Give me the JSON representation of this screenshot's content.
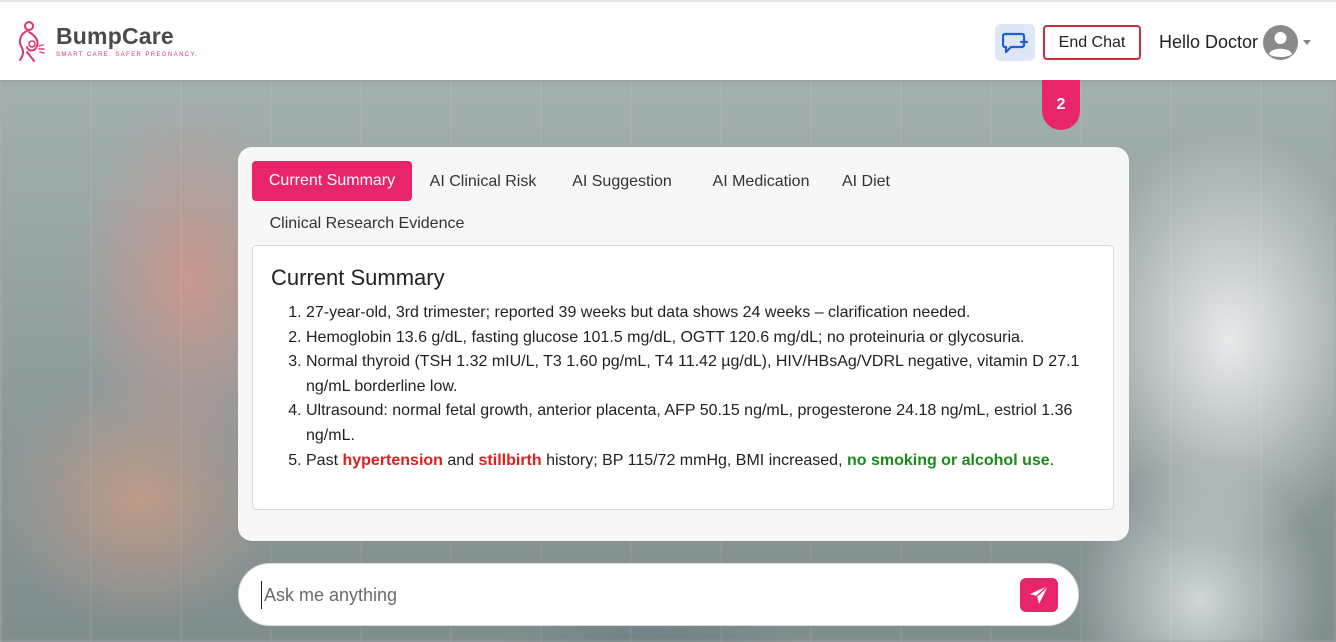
{
  "app": {
    "name": "BumpCare",
    "tagline": "SMART CARE. SAFER PREGNANCY."
  },
  "header": {
    "end_chat_label": "End Chat",
    "greeting": "Hello Doctor",
    "notification_count": "2"
  },
  "tabs": [
    {
      "label": "Current Summary",
      "active": true
    },
    {
      "label": "AI Clinical Risk",
      "active": false
    },
    {
      "label": "AI Suggestion",
      "active": false
    },
    {
      "label": "AI Medication",
      "active": false
    },
    {
      "label": "AI Diet",
      "active": false
    },
    {
      "label": "Clinical Research Evidence",
      "active": false
    }
  ],
  "summary": {
    "title": "Current Summary",
    "items": [
      {
        "text": "27-year-old, 3rd trimester; reported 39 weeks but data shows 24 weeks – clarification needed."
      },
      {
        "text": "Hemoglobin 13.6 g/dL, fasting glucose 101.5 mg/dL, OGTT 120.6 mg/dL; no proteinuria or glycosuria."
      },
      {
        "text": "Normal thyroid (TSH 1.32 mIU/L, T3 1.60 pg/mL, T4 11.42 µg/dL), HIV/HBsAg/VDRL negative, vitamin D 27.1 ng/mL borderline low."
      },
      {
        "text": "Ultrasound: normal fetal growth, anterior placenta, AFP 50.15 ng/mL, progesterone 24.18 ng/mL, estriol 1.36 ng/mL."
      },
      {
        "part1": "Past ",
        "highlight1": "hypertension",
        "part2": " and ",
        "highlight2": "stillbirth",
        "part3": " history; BP 115/72 mmHg, BMI increased, ",
        "highlight3": "no smoking or alcohol use",
        "part4": "."
      }
    ]
  },
  "chat": {
    "placeholder": "Ask me anything",
    "value": ""
  },
  "colors": {
    "accent": "#e8256b",
    "end_chat_border": "#c62f3a",
    "risk_red": "#e01e1e",
    "safe_green": "#1a8a1a"
  },
  "icons": {
    "new_chat": "chat-plus-icon",
    "avatar": "user-avatar-icon",
    "dropdown": "caret-down-icon",
    "send": "paper-plane-icon",
    "logo": "pregnant-mother-logo"
  }
}
